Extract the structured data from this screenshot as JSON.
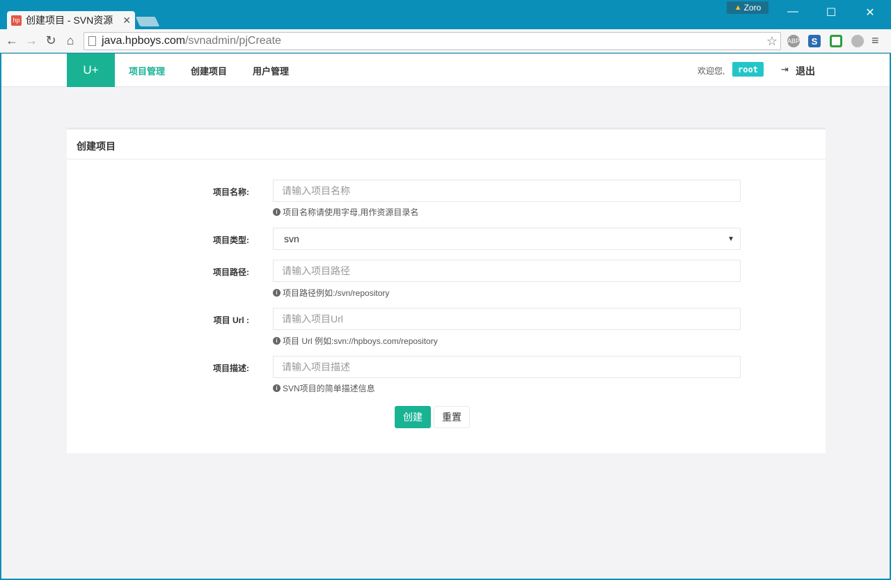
{
  "browser": {
    "tab_title": "创建项目 - SVN资源",
    "tab_favicon": "hp",
    "profile_name": "Zoro",
    "url_host": "java.hpboys.com",
    "url_path": "/svnadmin/pjCreate",
    "extensions": [
      {
        "icon": "abp-icon",
        "label": "ABP",
        "color": "#9a9a9a"
      },
      {
        "icon": "s-icon",
        "label": "S",
        "color": "#2b6cb0"
      },
      {
        "icon": "green-square-icon",
        "label": "",
        "color": "#2e9e3e"
      },
      {
        "icon": "moon-icon",
        "label": "",
        "color": "#b9b9b9"
      }
    ]
  },
  "header": {
    "brand": "U+",
    "nav": [
      {
        "label": "项目管理",
        "active": true
      },
      {
        "label": "创建项目",
        "active": false
      },
      {
        "label": "用户管理",
        "active": false
      }
    ],
    "welcome": "欢迎您,",
    "username": "root",
    "logout": "退出"
  },
  "panel": {
    "title": "创建项目",
    "fields": {
      "name": {
        "label": "项目名称:",
        "placeholder": "请输入项目名称",
        "help": "项目名称请使用字母,用作资源目录名"
      },
      "type": {
        "label": "项目类型:",
        "value": "svn"
      },
      "path": {
        "label": "项目路径:",
        "placeholder": "请输入项目路径",
        "help": "项目路径例如:/svn/repository"
      },
      "url": {
        "label": "项目 Url :",
        "placeholder": "请输入项目Url",
        "help": "项目 Url 例如:svn://hpboys.com/repository"
      },
      "desc": {
        "label": "项目描述:",
        "placeholder": "请输入项目描述",
        "help": "SVN项目的简单描述信息"
      }
    },
    "submit_label": "创建",
    "reset_label": "重置"
  }
}
